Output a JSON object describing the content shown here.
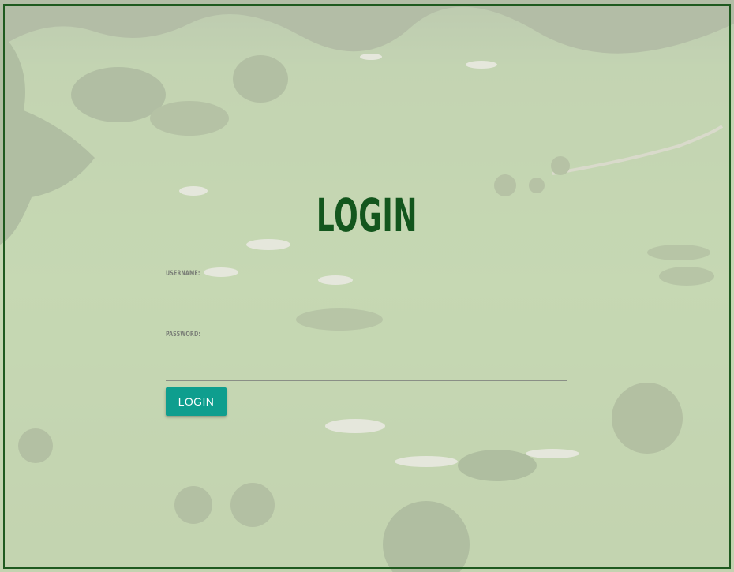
{
  "colors": {
    "title": "#13561d",
    "frame_border": "#1f5a1f",
    "button": "#0e9e8e",
    "label": "#7a7e77",
    "underline": "#8a8f86"
  },
  "page": {
    "title": "LOGIN"
  },
  "form": {
    "username": {
      "label": "USERNAME:",
      "value": ""
    },
    "password": {
      "label": "PASSWORD:",
      "value": ""
    },
    "submit_label": "LOGIN"
  },
  "background": {
    "icon": "golf-course-landscape-photo"
  }
}
